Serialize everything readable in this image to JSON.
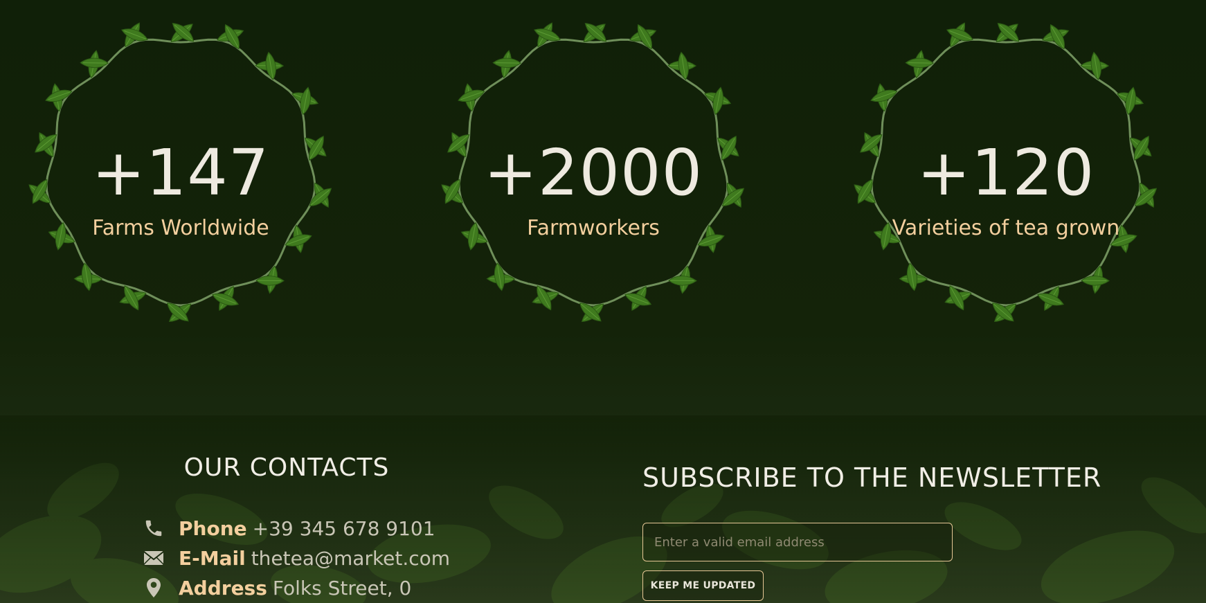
{
  "stats": [
    {
      "number": "+147",
      "label": "Farms Worldwide"
    },
    {
      "number": "+2000",
      "label": "Farmworkers"
    },
    {
      "number": "+120",
      "label": "Varieties of tea grown"
    }
  ],
  "contacts": {
    "title": "OUR CONTACTS",
    "items": [
      {
        "icon": "phone-icon",
        "key": "Phone",
        "value": "+39 345 678 9101"
      },
      {
        "icon": "envelope-icon",
        "key": "E-Mail",
        "value": "thetea@market.com"
      },
      {
        "icon": "map-pin-icon",
        "key": "Address",
        "value": "Folks Street, 0"
      }
    ]
  },
  "newsletter": {
    "title": "SUBSCRIBE TO THE NEWSLETTER",
    "email_placeholder": "Enter a valid email address",
    "button_label": "KEEP ME UPDATED"
  },
  "colors": {
    "background": "#12200a",
    "number": "#eeeae0",
    "label": "#f3cf9e",
    "leaf": "#3f7a1e",
    "stem": "#6f8f5a",
    "border_accent": "#e7c896"
  }
}
